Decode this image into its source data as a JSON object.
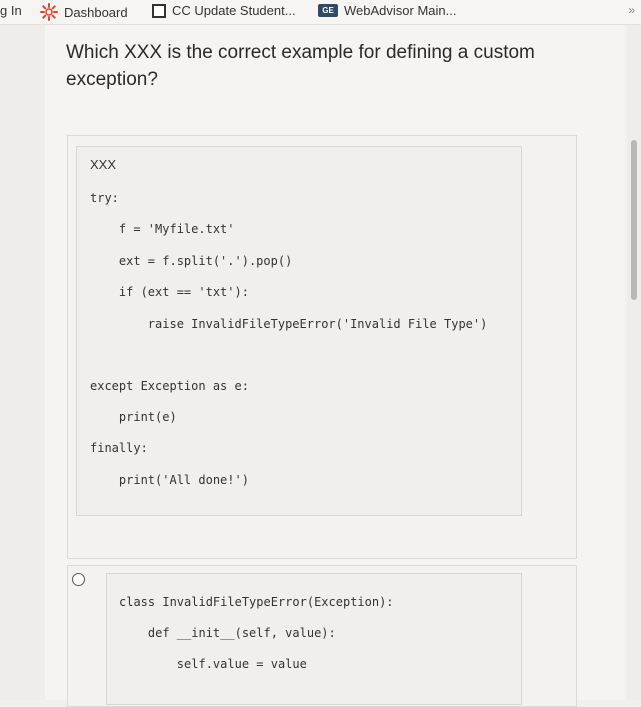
{
  "bookmarks": [
    {
      "label": "g In",
      "icon": "none"
    },
    {
      "label": "Dashboard",
      "icon": "canvas-star-icon"
    },
    {
      "label": "CC Update Student...",
      "icon": "square-icon"
    },
    {
      "label": "WebAdvisor Main...",
      "icon": "ge-icon"
    }
  ],
  "bookmark_icon_text": "GE",
  "overflow_chevron": "»",
  "colors": {
    "canvas_red": "#e0452c",
    "ge_blue": "#2f4a66"
  },
  "question": {
    "text": "Which XXX is the correct example for defining a custom exception?"
  },
  "code_block": {
    "placeholder": "XXX",
    "lines": [
      "try:",
      "    f = 'Myfile.txt'",
      "    ext = f.split('.').pop()",
      "    if (ext == 'txt'):",
      "        raise InvalidFileTypeError('Invalid File Type')",
      "except Exception as e:",
      "    print(e)",
      "finally:",
      "    print('All done!')"
    ]
  },
  "answer_option": {
    "lines": [
      "class InvalidFileTypeError(Exception):",
      "    def __init__(self, value):",
      "        self.value = value"
    ]
  }
}
